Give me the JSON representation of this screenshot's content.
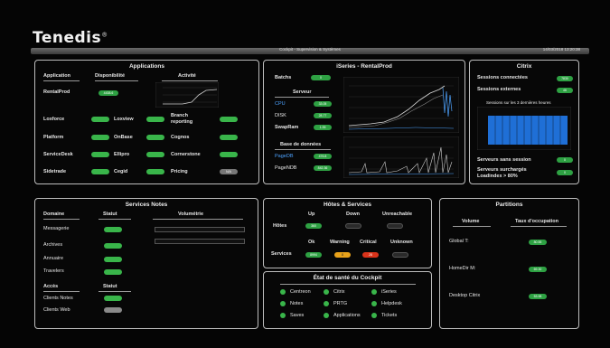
{
  "header": {
    "logo": "Tenedis",
    "subtitle": "Cockpit - Supervision & Systèmes",
    "datetime": "14/03/2018 13:20:38"
  },
  "applications": {
    "title": "Applications",
    "headers": {
      "app": "Application",
      "dispo": "Disponibilité",
      "activity": "Activité"
    },
    "rentalprod": {
      "label": "RentalProd",
      "value": "4438.6"
    },
    "items": [
      {
        "label": "Loxforce",
        "status": "green"
      },
      {
        "label": "Loxview",
        "status": "green"
      },
      {
        "label": "Branch reporting",
        "status": "green"
      },
      {
        "label": "Platform",
        "status": "green"
      },
      {
        "label": "OnBase",
        "status": "green"
      },
      {
        "label": "Cognos",
        "status": "green"
      },
      {
        "label": "ServiceDesk",
        "status": "green"
      },
      {
        "label": "Ellipro",
        "status": "green"
      },
      {
        "label": "Cornerstone",
        "status": "green"
      },
      {
        "label": "Sidetrade",
        "status": "green"
      },
      {
        "label": "Cegid",
        "status": "green"
      },
      {
        "label": "Pricing",
        "status": "gray",
        "value": "N/A"
      }
    ]
  },
  "iseries": {
    "title": "iSeries - RentalProd",
    "batchs": {
      "label": "Batchs",
      "value": "0"
    },
    "serveur_title": "Serveur",
    "serveur": [
      {
        "label": "CPU",
        "value": "33.05"
      },
      {
        "label": "DISK",
        "value": "28.77"
      },
      {
        "label": "SwapRam",
        "value": "1.35"
      }
    ],
    "bdd_title": "Base de données",
    "bdd": [
      {
        "label": "PageDB",
        "value": "476.8"
      },
      {
        "label": "PageNDB",
        "value": "842.36"
      }
    ]
  },
  "citrix": {
    "title": "Citrix",
    "connected": {
      "label": "Sessions connectées",
      "value": "7830"
    },
    "external": {
      "label": "Sessions externes",
      "value": "46"
    },
    "chart_title": "Sessions sur les 3 dernières heures",
    "no_session": {
      "label": "Serveurs sans session",
      "value": "0"
    },
    "overloaded": {
      "label": "Serveurs surchargés Loadindex > 80%",
      "value": "0"
    }
  },
  "services_notes": {
    "title": "Services Notes",
    "headers": {
      "domaine": "Domaine",
      "statut": "Statut",
      "volumetrie": "Volumétrie"
    },
    "items": [
      {
        "label": "Messagerie"
      },
      {
        "label": "Archives"
      },
      {
        "label": "Annuaire"
      },
      {
        "label": "Travelers"
      }
    ],
    "acces_headers": {
      "acces": "Accès",
      "statut": "Statut"
    },
    "acces": [
      {
        "label": "Clients Notes",
        "status": "green"
      },
      {
        "label": "Clients Web",
        "status": "gray"
      }
    ]
  },
  "hosts": {
    "title": "Hôtes & Services",
    "host_headers": [
      "Up",
      "Down",
      "Unreachable"
    ],
    "hotes_label": "Hôtes",
    "hotes_values": [
      "360",
      "",
      ""
    ],
    "service_headers": [
      "Ok",
      "Warning",
      "Critical",
      "Unknown"
    ],
    "services_label": "Services",
    "services_values": [
      "8994",
      "8",
      "28",
      ""
    ]
  },
  "cockpit": {
    "title": "État de santé du Cockpit",
    "items": [
      "Centreon",
      "Citrix",
      "iSeries",
      "Notes",
      "PRTG",
      "Helpdesk",
      "Saves",
      "Applications",
      "Tickets"
    ]
  },
  "partitions": {
    "title": "Partitions",
    "headers": {
      "volume": "Volume",
      "taux": "Taux d'occupation"
    },
    "items": [
      {
        "label": "Global T:",
        "value": "80.55"
      },
      {
        "label": "HomeDir M:",
        "value": "69.30"
      },
      {
        "label": "Desktop Citrix",
        "value": "53.98"
      }
    ]
  },
  "colors": {
    "green": "#39b54a",
    "gray": "#8a8a8a",
    "orange": "#e8a21a",
    "red": "#d9331a",
    "blue": "#4da3ff"
  }
}
